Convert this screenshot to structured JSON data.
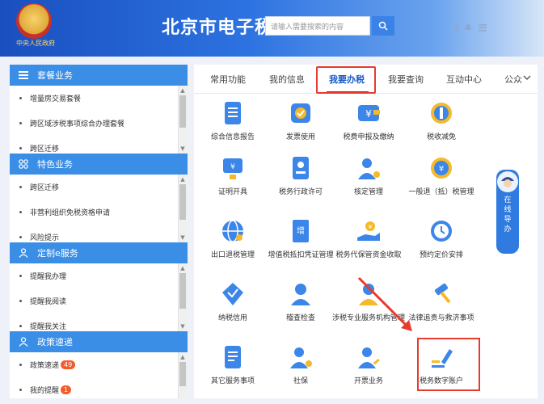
{
  "header": {
    "emblem_text": "中央人民政府",
    "title": "北京市电子税务",
    "search_placeholder": "请输入需要搜索的内容",
    "icons": [
      "user-icon",
      "bell-icon",
      "menu-icon"
    ]
  },
  "left": {
    "sections": [
      {
        "title": "套餐业务",
        "icon": "list-icon",
        "items": [
          {
            "label": "增量房交易套餐"
          },
          {
            "label": "跨区域涉税事项综合办理套餐"
          },
          {
            "label": "跨区迁移"
          }
        ]
      },
      {
        "title": "特色业务",
        "icon": "grid-icon",
        "items": [
          {
            "label": "跨区迁移"
          },
          {
            "label": "非营利组织免税资格申请"
          },
          {
            "label": "风险提示"
          }
        ]
      },
      {
        "title": "定制e服务",
        "icon": "person-icon",
        "items": [
          {
            "label": "提醒我办理"
          },
          {
            "label": "提醒我阅读"
          },
          {
            "label": "提醒我关注"
          }
        ]
      },
      {
        "title": "政策速递",
        "icon": "person-icon",
        "items": [
          {
            "label": "政策速递",
            "badge": "49"
          },
          {
            "label": "我的提醒",
            "badge": "1"
          }
        ]
      }
    ]
  },
  "tabs": [
    {
      "label": "常用功能"
    },
    {
      "label": "我的信息"
    },
    {
      "label": "我要办税",
      "active": true
    },
    {
      "label": "我要查询"
    },
    {
      "label": "互动中心"
    },
    {
      "label": "公众"
    }
  ],
  "tiles": [
    {
      "label": "综合信息报告",
      "icon": "report-icon"
    },
    {
      "label": "发票使用",
      "icon": "invoice-check-icon"
    },
    {
      "label": "税费申报及缴纳",
      "icon": "wallet-yuan-icon"
    },
    {
      "label": "税收减免",
      "icon": "coin-reduce-icon"
    },
    {
      "label": "证明开具",
      "icon": "certificate-icon"
    },
    {
      "label": "税务行政许可",
      "icon": "id-card-icon"
    },
    {
      "label": "核定管理",
      "icon": "user-gear-icon"
    },
    {
      "label": "一般退（抵）税管理",
      "icon": "refund-icon"
    },
    {
      "label": "出口退税管理",
      "icon": "globe-icon"
    },
    {
      "label": "增值税抵扣凭证管理",
      "icon": "ticket-icon"
    },
    {
      "label": "税务代保管资金收取",
      "icon": "hand-money-icon"
    },
    {
      "label": "预约定价安排",
      "icon": "clock-icon"
    },
    {
      "label": "纳税信用",
      "icon": "diamond-check-icon"
    },
    {
      "label": "稽查检查",
      "icon": "inspector-icon"
    },
    {
      "label": "涉税专业服务机构管理",
      "icon": "agent-icon"
    },
    {
      "label": "法律追责与救济事项",
      "icon": "gavel-icon"
    },
    {
      "label": "其它服务事项",
      "icon": "list-doc-icon"
    },
    {
      "label": "社保",
      "icon": "user-shield-icon"
    },
    {
      "label": "开票业务",
      "icon": "user-edit-icon"
    },
    {
      "label": "税务数字账户",
      "icon": "pen-lines-icon",
      "highlighted": true
    }
  ],
  "float_assistant": {
    "label": "在线导办"
  },
  "colors": {
    "accent": "#1a5ac8",
    "section_header": "#3a8ee6",
    "highlight_red": "#e63b2e",
    "tile_blue": "#3b86e8",
    "tile_yellow": "#f5b92a",
    "badge": "#f25c2b"
  }
}
